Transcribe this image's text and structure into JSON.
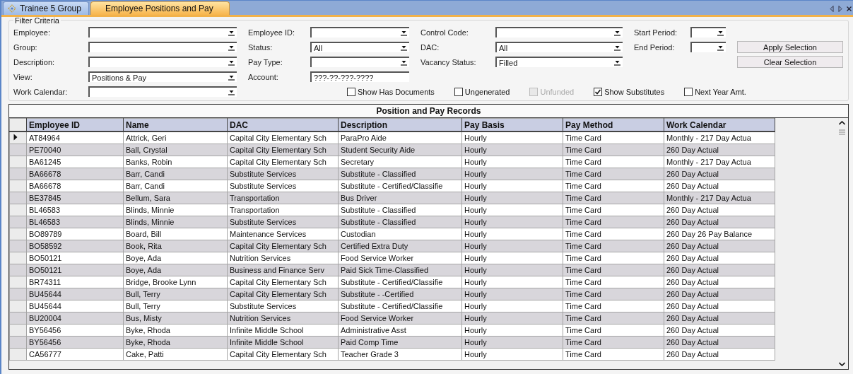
{
  "tabs": [
    {
      "label": "Trainee 5 Group",
      "selected": false,
      "has_icon": true
    },
    {
      "label": "Employee Positions and Pay",
      "selected": true,
      "has_icon": false
    }
  ],
  "filter": {
    "title": "Filter Criteria",
    "columns": [
      [
        {
          "label": "Employee:",
          "kind": "dropdown"
        },
        {
          "label": "Group:",
          "kind": "dropdown"
        },
        {
          "label": "Description:",
          "kind": "dropdown"
        },
        {
          "label": "View:",
          "value": "Positions & Pay",
          "kind": "dropdown"
        },
        {
          "label": "Work Calendar:",
          "kind": "dropdown"
        }
      ],
      [
        {
          "label": "Employee ID:",
          "kind": "dropdown"
        },
        {
          "label": "Status:",
          "value": "All",
          "kind": "dropdown"
        },
        {
          "label": "Pay Type:",
          "kind": "dropdown"
        },
        {
          "label": "Account:",
          "value": "???-??-???-????",
          "kind": "text"
        }
      ],
      [
        {
          "label": "Control Code:",
          "kind": "dropdown"
        },
        {
          "label": "DAC:",
          "value": "All",
          "kind": "dropdown"
        },
        {
          "label": "Vacancy Status:",
          "value": "Filled",
          "kind": "dropdown"
        }
      ],
      [
        {
          "label": "Start Period:",
          "kind": "dropdown"
        },
        {
          "label": "End Period:",
          "kind": "dropdown"
        }
      ]
    ],
    "checkboxes": [
      {
        "label": "Show Has Documents",
        "checked": false,
        "disabled": false
      },
      {
        "label": "Ungenerated",
        "checked": false,
        "disabled": false
      },
      {
        "label": "Unfunded",
        "checked": false,
        "disabled": true
      },
      {
        "label": "Show Substitutes",
        "checked": true,
        "disabled": false
      },
      {
        "label": "Next Year Amt.",
        "checked": false,
        "disabled": false
      }
    ],
    "buttons": [
      "Apply Selection",
      "Clear Selection"
    ]
  },
  "table": {
    "title": "Position and Pay Records",
    "columns": [
      "Employee ID",
      "Name",
      "DAC",
      "Description",
      "Pay Basis",
      "Pay Method",
      "Work Calendar"
    ],
    "rows": [
      {
        "current": true,
        "cells": [
          "AT84964",
          "Attrick, Geri",
          "Capital City Elementary Sch",
          "ParaPro Aide",
          "Hourly",
          "Time Card",
          "Monthly - 217 Day  Actua"
        ]
      },
      {
        "current": false,
        "cells": [
          "PE70040",
          "Ball, Crystal",
          "Capital City Elementary Sch",
          "Student Security Aide",
          "Hourly",
          "Time Card",
          "260 Day Actual"
        ]
      },
      {
        "current": false,
        "cells": [
          "BA61245",
          "Banks, Robin",
          "Capital City Elementary Sch",
          "Secretary",
          "Hourly",
          "Time Card",
          "Monthly - 217 Day  Actua"
        ]
      },
      {
        "current": false,
        "cells": [
          "BA66678",
          "Barr, Candi",
          "Substitute Services",
          "Substitute - Classified",
          "Hourly",
          "Time Card",
          "260 Day Actual"
        ]
      },
      {
        "current": false,
        "cells": [
          "BA66678",
          "Barr, Candi",
          "Substitute Services",
          "Substitute  - Certified/Classifie",
          "Hourly",
          "Time Card",
          "260 Day Actual"
        ]
      },
      {
        "current": false,
        "cells": [
          "BE37845",
          "Bellum, Sara",
          "Transportation",
          "Bus Driver",
          "Hourly",
          "Time Card",
          "Monthly - 217 Day  Actua"
        ]
      },
      {
        "current": false,
        "cells": [
          "BL46583",
          "Blinds, Minnie",
          "Transportation",
          "Substitute - Classified",
          "Hourly",
          "Time Card",
          "260 Day Actual"
        ]
      },
      {
        "current": false,
        "cells": [
          "BL46583",
          "Blinds, Minnie",
          "Substitute Services",
          "Substitute - Classified",
          "Hourly",
          "Time Card",
          "260 Day Actual"
        ]
      },
      {
        "current": false,
        "cells": [
          "BO89789",
          "Board, Bill",
          "Maintenance Services",
          "Custodian",
          "Hourly",
          "Time Card",
          "260 Day 26 Pay Balance"
        ]
      },
      {
        "current": false,
        "cells": [
          "BO58592",
          "Book, Rita",
          "Capital City Elementary Sch",
          "Certified Extra Duty",
          "Hourly",
          "Time Card",
          "260 Day Actual"
        ]
      },
      {
        "current": false,
        "cells": [
          "BO50121",
          "Boye, Ada",
          "Nutrition Services",
          "Food Service Worker",
          "Hourly",
          "Time Card",
          "260 Day Actual"
        ]
      },
      {
        "current": false,
        "cells": [
          "BO50121",
          "Boye, Ada",
          "Business and Finance Serv",
          "Paid Sick Time-Classified",
          "Hourly",
          "Time Card",
          "260 Day Actual"
        ]
      },
      {
        "current": false,
        "cells": [
          "BR74311",
          "Bridge, Brooke Lynn",
          "Capital City Elementary Sch",
          "Substitute  - Certified/Classifie",
          "Hourly",
          "Time Card",
          "260 Day Actual"
        ]
      },
      {
        "current": false,
        "cells": [
          "BU45644",
          "Bull, Terry",
          "Capital City Elementary Sch",
          "Substitute - -Certified",
          "Hourly",
          "Time Card",
          "260 Day Actual"
        ]
      },
      {
        "current": false,
        "cells": [
          "BU45644",
          "Bull, Terry",
          "Substitute Services",
          "Substitute  - Certified/Classifie",
          "Hourly",
          "Time Card",
          "260 Day Actual"
        ]
      },
      {
        "current": false,
        "cells": [
          "BU20004",
          "Bus, Misty",
          "Nutrition Services",
          "Food Service Worker",
          "Hourly",
          "Time Card",
          "260 Day Actual"
        ]
      },
      {
        "current": false,
        "cells": [
          "BY56456",
          "Byke, Rhoda",
          "Infinite Middle School",
          "Administrative Asst",
          "Hourly",
          "Time Card",
          "260 Day Actual"
        ]
      },
      {
        "current": false,
        "cells": [
          "BY56456",
          "Byke, Rhoda",
          "Infinite Middle School",
          "Paid Comp Time",
          "Hourly",
          "Time Card",
          "260 Day Actual"
        ]
      },
      {
        "current": false,
        "cells": [
          "CA56777",
          "Cake, Patti",
          "Capital City Elementary Sch",
          "Teacher Grade 3",
          "Hourly",
          "Time Card",
          "260 Day Actual"
        ]
      }
    ]
  }
}
